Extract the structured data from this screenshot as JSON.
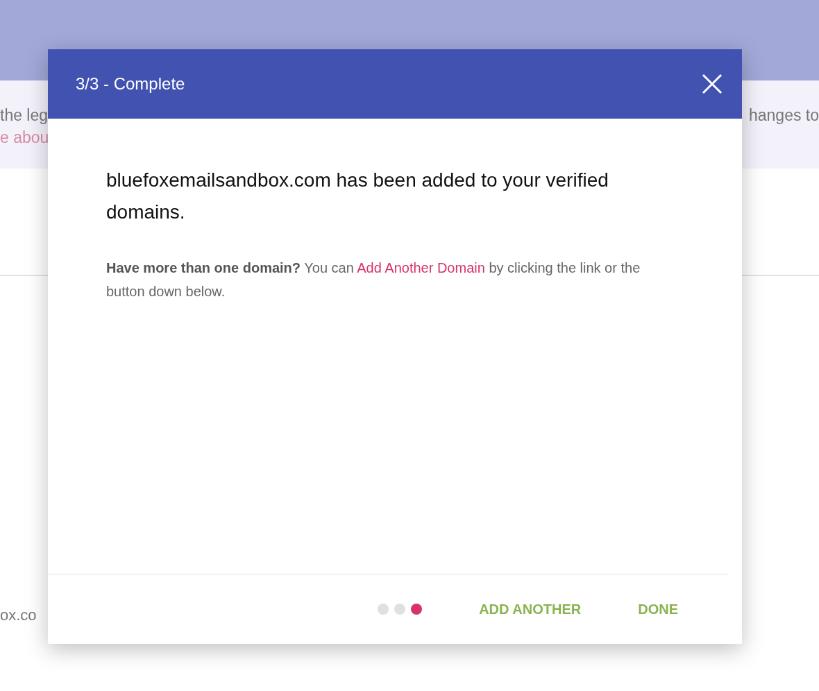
{
  "background": {
    "banner_left_line_1": "the leg",
    "banner_left_line_2": "e abou",
    "banner_right_line_1": "hanges to",
    "list_text": "ox.co"
  },
  "dialog": {
    "title": "3/3 - Complete",
    "heading": "bluefoxemailsandbox.com has been added to your verified domains.",
    "note": {
      "lead": "Have more than one domain?",
      "before_link": " You can ",
      "link": "Add Another Domain",
      "after_link": " by clicking the link or the button down below."
    },
    "steps": [
      {
        "selected": false
      },
      {
        "selected": false
      },
      {
        "selected": true
      }
    ],
    "buttons": [
      "ADD ANOTHER",
      "DONE"
    ]
  }
}
